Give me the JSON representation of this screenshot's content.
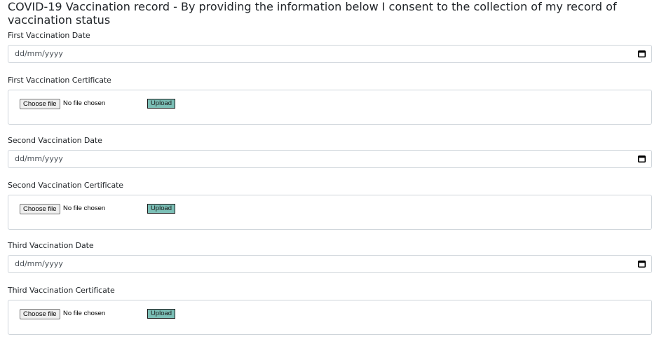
{
  "form": {
    "title": "COVID-19 Vaccination record - By providing the information below I consent to the collection of my record of vaccination status",
    "sections": [
      {
        "date_label": "First Vaccination Date",
        "date_placeholder": "dd/mm/yyyy",
        "cert_label": "First Vaccination Certificate",
        "choose_file": "Choose file",
        "no_file": "No file chosen",
        "upload": "Upload"
      },
      {
        "date_label": "Second Vaccination Date",
        "date_placeholder": "dd/mm/yyyy",
        "cert_label": "Second Vaccination Certificate",
        "choose_file": "Choose file",
        "no_file": "No file chosen",
        "upload": "Upload"
      },
      {
        "date_label": "Third Vaccination Date",
        "date_placeholder": "dd/mm/yyyy",
        "cert_label": "Third Vaccination Certificate",
        "choose_file": "Choose file",
        "no_file": "No file chosen",
        "upload": "Upload"
      }
    ]
  },
  "icons": {
    "calendar": "calendar-icon"
  },
  "colors": {
    "upload_button": "#7bbfb6",
    "border": "#ced4da"
  }
}
